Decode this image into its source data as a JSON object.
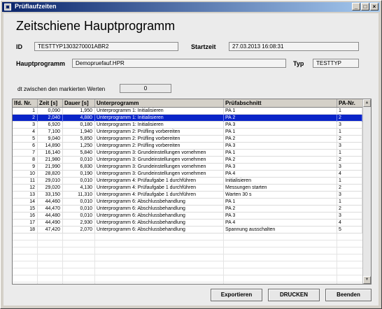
{
  "window": {
    "title": "Prüflaufzeiten",
    "buttons": {
      "minimize": "_",
      "maximize": "□",
      "close": "×"
    }
  },
  "heading": "Zeitschiene Hauptprogramm",
  "fields": {
    "id_label": "ID",
    "id_value": "TESTTYP1303270001ABR2",
    "startzeit_label": "Startzeit",
    "startzeit_value": "27.03.2013 16:08:31",
    "hauptprogramm_label": "Hauptprogramm",
    "hauptprogramm_value": "Demopruefauf.HPR",
    "typ_label": "Typ",
    "typ_value": "TESTTYP",
    "dt_label": "dt zwischen den markierten Werten",
    "dt_value": "0"
  },
  "table": {
    "columns": [
      "lfd. Nr.",
      "Zeit [s]",
      "Dauer [s]",
      "Unterprogramm",
      "Prüfabschnitt",
      "PA-Nr."
    ],
    "selected_row": 1,
    "rows": [
      [
        "1",
        "0,090",
        "1,950",
        "Unterprogramm 1: Initialisieren",
        "PA 1",
        "1"
      ],
      [
        "2",
        "2,040",
        "4,880",
        "Unterprogramm 1: Initialisieren",
        "PA 2",
        "2"
      ],
      [
        "3",
        "6,920",
        "0,180",
        "Unterprogramm 1: Initialisieren",
        "PA 3",
        "3"
      ],
      [
        "4",
        "7,100",
        "1,940",
        "Unterprogramm 2: Prüfling vorbereiten",
        "PA 1",
        "1"
      ],
      [
        "5",
        "9,040",
        "5,850",
        "Unterprogramm 2: Prüfling vorbereiten",
        "PA 2",
        "2"
      ],
      [
        "6",
        "14,890",
        "1,250",
        "Unterprogramm 2: Prüfling vorbereiten",
        "PA 3",
        "3"
      ],
      [
        "7",
        "16,140",
        "5,840",
        "Unterprogramm 3: Grundeinstellungen vornehmen",
        "PA 1",
        "1"
      ],
      [
        "8",
        "21,980",
        "0,010",
        "Unterprogramm 3: Grundeinstellungen vornehmen",
        "PA 2",
        "2"
      ],
      [
        "9",
        "21,990",
        "6,830",
        "Unterprogramm 3: Grundeinstellungen vornehmen",
        "PA 3",
        "3"
      ],
      [
        "10",
        "28,820",
        "0,190",
        "Unterprogramm 3: Grundeinstellungen vornehmen",
        "PA 4",
        "4"
      ],
      [
        "11",
        "29,010",
        "0,010",
        "Unterprogramm 4: Prüfaufgabe 1 durchführen",
        "Initialisieren",
        "1"
      ],
      [
        "12",
        "29,020",
        "4,130",
        "Unterprogramm 4: Prüfaufgabe 1 durchführen",
        "Messungen starten",
        "2"
      ],
      [
        "13",
        "33,150",
        "11,310",
        "Unterprogramm 4: Prüfaufgabe 1 durchführen",
        "Warten 30 s",
        "3"
      ],
      [
        "14",
        "44,460",
        "0,010",
        "Unterprogramm 6: Abschlussbehandlung",
        "PA 1",
        "1"
      ],
      [
        "15",
        "44,470",
        "0,010",
        "Unterprogramm 6: Abschlussbehandlung",
        "PA 2",
        "2"
      ],
      [
        "16",
        "44,480",
        "0,010",
        "Unterprogramm 6: Abschlussbehandlung",
        "PA 3",
        "3"
      ],
      [
        "17",
        "44,490",
        "2,930",
        "Unterprogramm 6: Abschlussbehandlung",
        "PA 4",
        "4"
      ],
      [
        "18",
        "47,420",
        "2,070",
        "Unterprogramm 6: Abschlussbehandlung",
        "Spannung ausschalten",
        "5"
      ]
    ]
  },
  "actions": {
    "export": "Exportieren",
    "print": "DRUCKEN",
    "exit": "Beenden"
  },
  "colors": {
    "selection": "#0a24c8",
    "titlebar_start": "#0a246a",
    "titlebar_end": "#a6caf0"
  }
}
